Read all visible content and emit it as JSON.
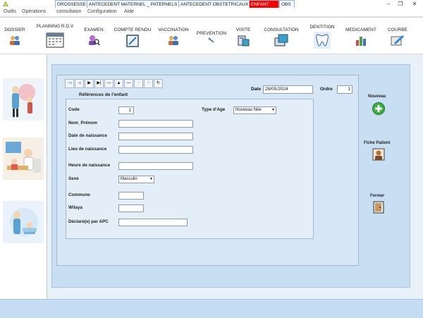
{
  "menu": [
    "Outils",
    "Opérations",
    "consultaion",
    "Configuration",
    "Aide"
  ],
  "window_controls": {
    "minimize": "–",
    "maximize": "❐",
    "close": "✕"
  },
  "toolbar": {
    "dossier": "DOSSIER",
    "planning": "PLANNING R.D.V",
    "examen": "EXAMEN",
    "compte_rendu": "COMPTE RENDU",
    "vaccination": "VACCINATION",
    "prevention": "PREVENTION",
    "visite": "VISITE",
    "consultation": "CONSULTATION",
    "dentition": "DENTITION",
    "medicament": "MEDICAMENT",
    "courbe": "COURBE"
  },
  "tabs": [
    "GROSSESSE",
    "ANTECEDENT MATERNEL _ PATERNELS",
    "ANTECEDENT OBSTETRICAUX",
    "ENFANT",
    "OBS"
  ],
  "active_tab": "ENFANT",
  "nav_buttons": [
    "|◀",
    "◀",
    "▶",
    "▶|",
    "—",
    "▲",
    "—",
    "✓",
    "✕",
    "↻"
  ],
  "form": {
    "section_title": "Références de l'enfant",
    "date_label": "Date",
    "date_value": "28/05/2024",
    "ordre_label": "Ordre",
    "ordre_value": "1",
    "code_label": "Code",
    "code_value": "1",
    "type_age_label": "Type d'Age",
    "type_age_value": "Nouveau Née",
    "nom_prenom_label": "Nom_Prénom",
    "nom_prenom_value": "",
    "date_naissance_label": "Date  de naissance",
    "date_naissance_value": "",
    "lieu_naissance_label": "Lieu de naissance",
    "lieu_naissance_value": "",
    "heure_naissance_label": "Heure  de naissance",
    "heure_naissance_value": "",
    "sexe_label": "Sexe",
    "sexe_value": "Masculin",
    "commune_label": "Commune",
    "commune_value": "",
    "wilaya_label": "Wilaya",
    "wilaya_value": "",
    "declare_label": "Déclaré(e) par APC",
    "declare_value": ""
  },
  "actions": {
    "nouveau": "Nouveau",
    "fiche_patient": "Fiche Patient",
    "fermer": "Fermer"
  },
  "colors": {
    "active_tab": "#ff0000",
    "panel_bg": "#c8def3",
    "nouveau_icon": "#3cb043"
  }
}
